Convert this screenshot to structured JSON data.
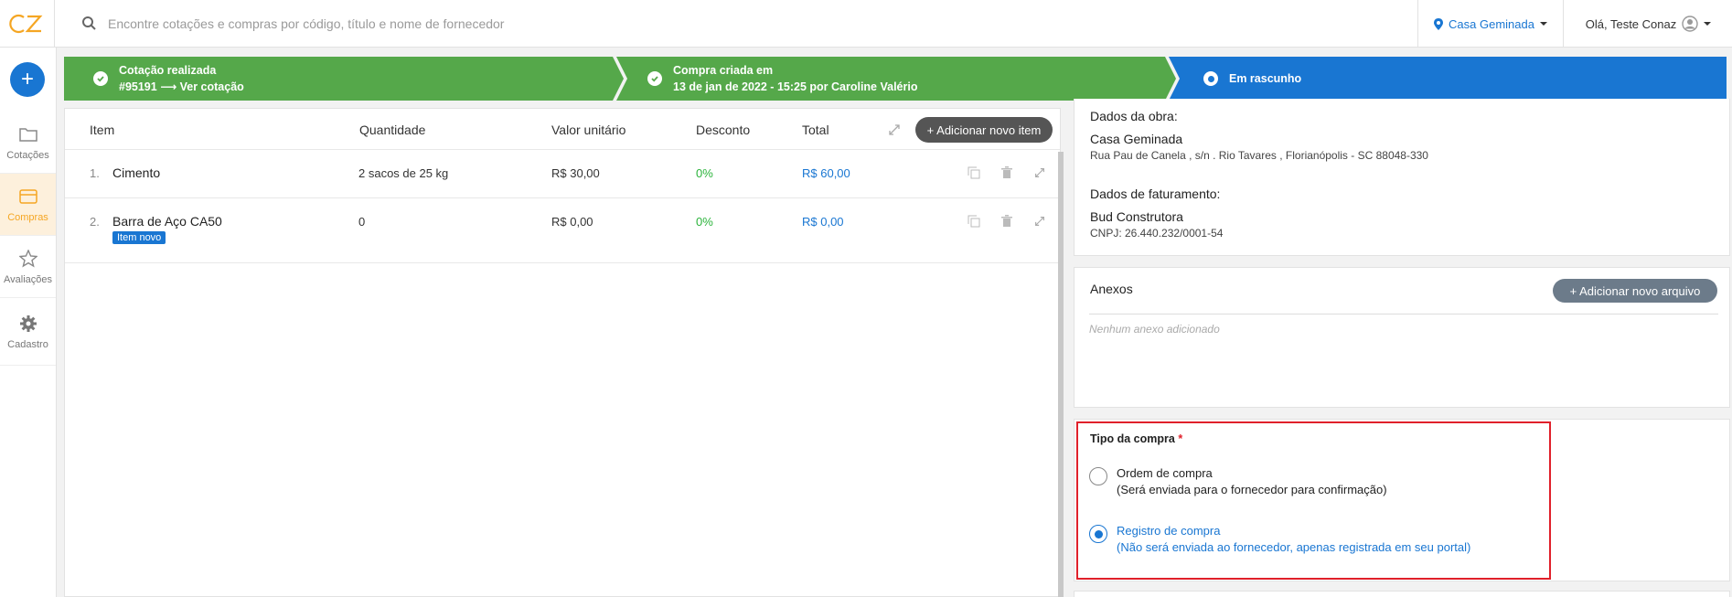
{
  "app": {
    "logo_text": "CZ",
    "accent_color": "#f5a623",
    "primary_color": "#1976d2",
    "success_color": "#55a84a"
  },
  "search": {
    "placeholder": "Encontre cotações e compras por código, título e nome de fornecedor",
    "value": ""
  },
  "header": {
    "location": "Casa Geminada",
    "greeting": "Olá, Teste Conaz"
  },
  "sidebar": {
    "add_label": "+",
    "items": [
      {
        "label": "Cotações",
        "icon": "folder-icon"
      },
      {
        "label": "Compras",
        "icon": "card-icon",
        "active": true
      },
      {
        "label": "Avaliações",
        "icon": "star-icon"
      },
      {
        "label": "Cadastro",
        "icon": "gear-icon"
      }
    ]
  },
  "stepper": {
    "steps": [
      {
        "line1": "Cotação realizada",
        "line2_code": "#95191",
        "line2_arrow": "⟶",
        "line2_link": "Ver cotação",
        "status": "done"
      },
      {
        "line1": "Compra criada em",
        "line2": "13 de jan de 2022 - 15:25 por Caroline Valério",
        "status": "done"
      },
      {
        "line1": "Em rascunho",
        "status": "current"
      }
    ]
  },
  "items_table": {
    "columns": [
      "Item",
      "Quantidade",
      "Valor unitário",
      "Desconto",
      "Total"
    ],
    "add_button": "+ Adicionar novo item",
    "rows": [
      {
        "index": "1.",
        "name": "Cimento",
        "badge": "",
        "quantity": "2 sacos de 25 kg",
        "unit_price": "R$ 30,00",
        "discount": "0%",
        "total": "R$ 60,00"
      },
      {
        "index": "2.",
        "name": "Barra de Aço CA50",
        "badge": "Item novo",
        "quantity": "0",
        "unit_price": "R$ 0,00",
        "discount": "0%",
        "total": "R$ 0,00"
      }
    ]
  },
  "obra": {
    "title": "Dados da obra:",
    "name": "Casa Geminada",
    "address": "Rua Pau de Canela , s/n . Rio Tavares , Florianópolis - SC 88048-330",
    "billing_title": "Dados de faturamento:",
    "billing_name": "Bud Construtora",
    "cnpj": "CNPJ: 26.440.232/0001-54"
  },
  "anexos": {
    "title": "Anexos",
    "add_button": "+ Adicionar novo arquivo",
    "empty_text": "Nenhum anexo adicionado"
  },
  "tipo_compra": {
    "title": "Tipo da compra",
    "required_mark": "*",
    "options": [
      {
        "label": "Ordem de compra",
        "description": "(Será enviada para o fornecedor para confirmação)",
        "selected": false
      },
      {
        "label": "Registro de compra",
        "description": "(Não será enviada ao fornecedor, apenas registrada em seu portal)",
        "selected": true
      }
    ]
  }
}
